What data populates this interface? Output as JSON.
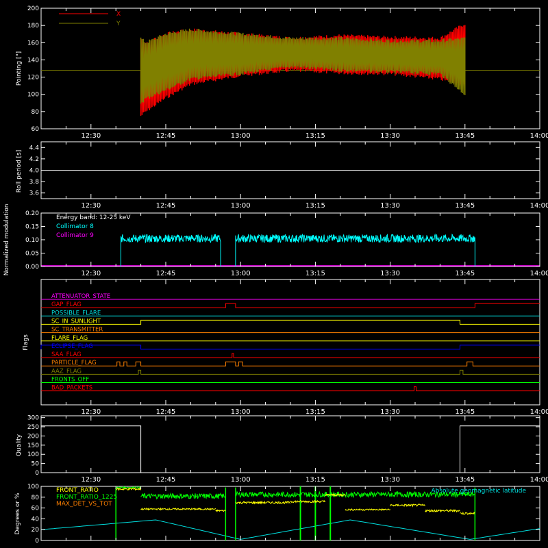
{
  "time_ticks": [
    "12:30",
    "12:45",
    "13:00",
    "13:15",
    "13:30",
    "13:45",
    "14:00"
  ],
  "chart_data": [
    {
      "id": "pointing",
      "type": "line",
      "ylabel": "Pointing [\"]",
      "ylim": [
        60,
        200
      ],
      "yticks": [
        "60",
        "80",
        "100",
        "120",
        "140",
        "160",
        "180",
        "200"
      ],
      "legend_placement": "top-left",
      "series": [
        {
          "name": "X",
          "color": "#ff0000",
          "x": [
            "12:40",
            "12:41",
            "12:45",
            "12:50",
            "13:00",
            "13:10",
            "13:20",
            "13:30",
            "13:40",
            "13:45"
          ],
          "upper": [
            165,
            160,
            170,
            175,
            170,
            165,
            168,
            166,
            165,
            182
          ],
          "lower": [
            75,
            80,
            96,
            112,
            122,
            128,
            125,
            124,
            118,
            110
          ]
        },
        {
          "name": "Y",
          "color": "#808000",
          "baseline": 128,
          "x": [
            "12:40",
            "12:41",
            "12:45",
            "12:50",
            "13:00",
            "13:10",
            "13:20",
            "13:30",
            "13:40",
            "13:45"
          ],
          "upper": [
            165,
            160,
            170,
            175,
            170,
            165,
            165,
            162,
            162,
            165
          ],
          "lower": [
            90,
            95,
            105,
            118,
            124,
            132,
            128,
            126,
            124,
            100
          ]
        }
      ]
    },
    {
      "id": "roll",
      "type": "line",
      "ylabel": "Roll period [s]",
      "ylim": [
        3.5,
        4.5
      ],
      "yticks": [
        "3.6",
        "3.8",
        "4.0",
        "4.2",
        "4.4"
      ],
      "series": [
        {
          "name": "",
          "color": "#ffffff",
          "x": [
            "12:20",
            "14:00"
          ],
          "y": [
            4.0,
            4.0
          ]
        }
      ]
    },
    {
      "id": "modulation",
      "type": "line",
      "ylabel": "Normalized modulation",
      "ylim": [
        0.0,
        0.2
      ],
      "yticks": [
        "0.00",
        "0.05",
        "0.10",
        "0.15",
        "0.20"
      ],
      "annotation": "Energy band: 12-25 keV",
      "legend_placement": "top-left",
      "series": [
        {
          "name": "Collimator 8",
          "color": "#00ffff",
          "segments": [
            {
              "start": "12:36",
              "end": "12:56",
              "level": 0.105,
              "noise": 0.015
            },
            {
              "start": "12:59",
              "end": "13:47",
              "level": 0.105,
              "noise": 0.015
            }
          ]
        },
        {
          "name": "Collimator 9",
          "color": "#ff00ff",
          "x": [
            "12:20",
            "14:00"
          ],
          "y": [
            0.0,
            0.0
          ]
        }
      ]
    },
    {
      "id": "flags",
      "type": "line",
      "ylabel": "Flags",
      "series": [
        {
          "name": "ATTENUATOR_STATE",
          "color": "#ff00ff",
          "pulses": []
        },
        {
          "name": "GAP_FLAG",
          "color": "#ff0000",
          "pulses": [
            [
              "12:57",
              "12:59"
            ],
            [
              "13:47",
              "14:00"
            ]
          ]
        },
        {
          "name": "POSSIBLE_FLARE",
          "color": "#00e0e0",
          "pulses": []
        },
        {
          "name": "SC_IN_SUNLIGHT",
          "color": "#ffff00",
          "pulses": [
            [
              "12:40",
              "13:44"
            ]
          ]
        },
        {
          "name": "SC_TRANSMITTER",
          "color": "#ff8000",
          "pulses": []
        },
        {
          "name": "FLARE_FLAG",
          "color": "#ffff00",
          "pulses": []
        },
        {
          "name": "ECLIPSE_FLAG",
          "color": "#0000ff",
          "pulses": [
            [
              "12:20",
              "12:40"
            ],
            [
              "13:44",
              "14:00"
            ]
          ]
        },
        {
          "name": "SAA_FLAG",
          "color": "#ff0000",
          "pulses": [
            [
              "12:58.3",
              "12:58.6"
            ]
          ]
        },
        {
          "name": "PARTICLE_FLAG",
          "color": "#ff8000",
          "pulses": [
            [
              "12:35.2",
              "12:35.8"
            ],
            [
              "12:36.6",
              "12:37.2"
            ],
            [
              "12:39",
              "12:40"
            ],
            [
              "12:57",
              "12:59"
            ],
            [
              "12:59.6",
              "13:00.4"
            ],
            [
              "13:45.4",
              "13:46.6"
            ]
          ]
        },
        {
          "name": "AAZ_FLAG",
          "color": "#808000",
          "pulses": [
            [
              "12:39.5",
              "12:40"
            ],
            [
              "13:44",
              "13:44.6"
            ]
          ]
        },
        {
          "name": "FRONTS_OFF",
          "color": "#00ff00",
          "pulses": []
        },
        {
          "name": "BAD_PACKETS",
          "color": "#ff0000",
          "pulses": [
            [
              "13:34.8",
              "13:35.2"
            ]
          ]
        }
      ]
    },
    {
      "id": "quality",
      "type": "line",
      "ylabel": "Quality",
      "ylim": [
        0,
        310
      ],
      "yticks": [
        "0",
        "50",
        "100",
        "150",
        "200",
        "250",
        "300"
      ],
      "series": [
        {
          "name": "",
          "color": "#ffffff",
          "x": [
            "12:20",
            "12:40",
            "12:40",
            "13:44",
            "13:44",
            "14:00"
          ],
          "y": [
            255,
            255,
            0,
            0,
            255,
            255
          ]
        }
      ]
    },
    {
      "id": "ratios",
      "type": "line",
      "ylabel": "Degrees or %",
      "ylim": [
        0,
        100
      ],
      "yticks": [
        "0",
        "20",
        "40",
        "60",
        "80",
        "100"
      ],
      "legend_placement": "top-left",
      "series": [
        {
          "name": "FRONT_RATIO",
          "color": "#ffff00",
          "segments": [
            {
              "start": "12:35",
              "end": "12:40",
              "level": 95,
              "noise": 2
            },
            {
              "start": "12:40",
              "end": "12:55",
              "level": 58,
              "noise": 1.5
            },
            {
              "start": "12:55",
              "end": "12:57",
              "level": 55,
              "noise": 1.5
            },
            {
              "start": "12:59",
              "end": "13:10",
              "level": 70,
              "noise": 2
            },
            {
              "start": "13:10",
              "end": "13:17",
              "level": 72,
              "noise": 2
            },
            {
              "start": "13:17",
              "end": "13:21",
              "level": 84,
              "noise": 2
            },
            {
              "start": "13:21",
              "end": "13:30",
              "level": 57,
              "noise": 1.5
            },
            {
              "start": "13:30",
              "end": "13:37",
              "level": 65,
              "noise": 2
            },
            {
              "start": "13:37",
              "end": "13:44",
              "level": 55,
              "noise": 2
            },
            {
              "start": "13:44",
              "end": "13:47",
              "level": 50,
              "noise": 2
            }
          ]
        },
        {
          "name": "FRONT_RATIO_1225",
          "color": "#00ff00",
          "segments": [
            {
              "start": "12:35",
              "end": "12:40",
              "level": 98,
              "noise": 1.5
            },
            {
              "start": "12:40",
              "end": "12:57",
              "level": 82,
              "noise": 5
            },
            {
              "start": "12:59",
              "end": "13:47",
              "level": 85,
              "noise": 5
            }
          ]
        },
        {
          "name": "MAX_DET_VS_TOT",
          "color": "#ff8000",
          "segments": []
        }
      ],
      "extra_label": "Absolute geomagnetic latitude",
      "latitude": {
        "color": "#00e0e0",
        "x": [
          "12:20",
          "12:43",
          "13:00",
          "13:22",
          "13:46",
          "14:00"
        ],
        "y": [
          20,
          38,
          2,
          38,
          2,
          22
        ]
      }
    }
  ]
}
